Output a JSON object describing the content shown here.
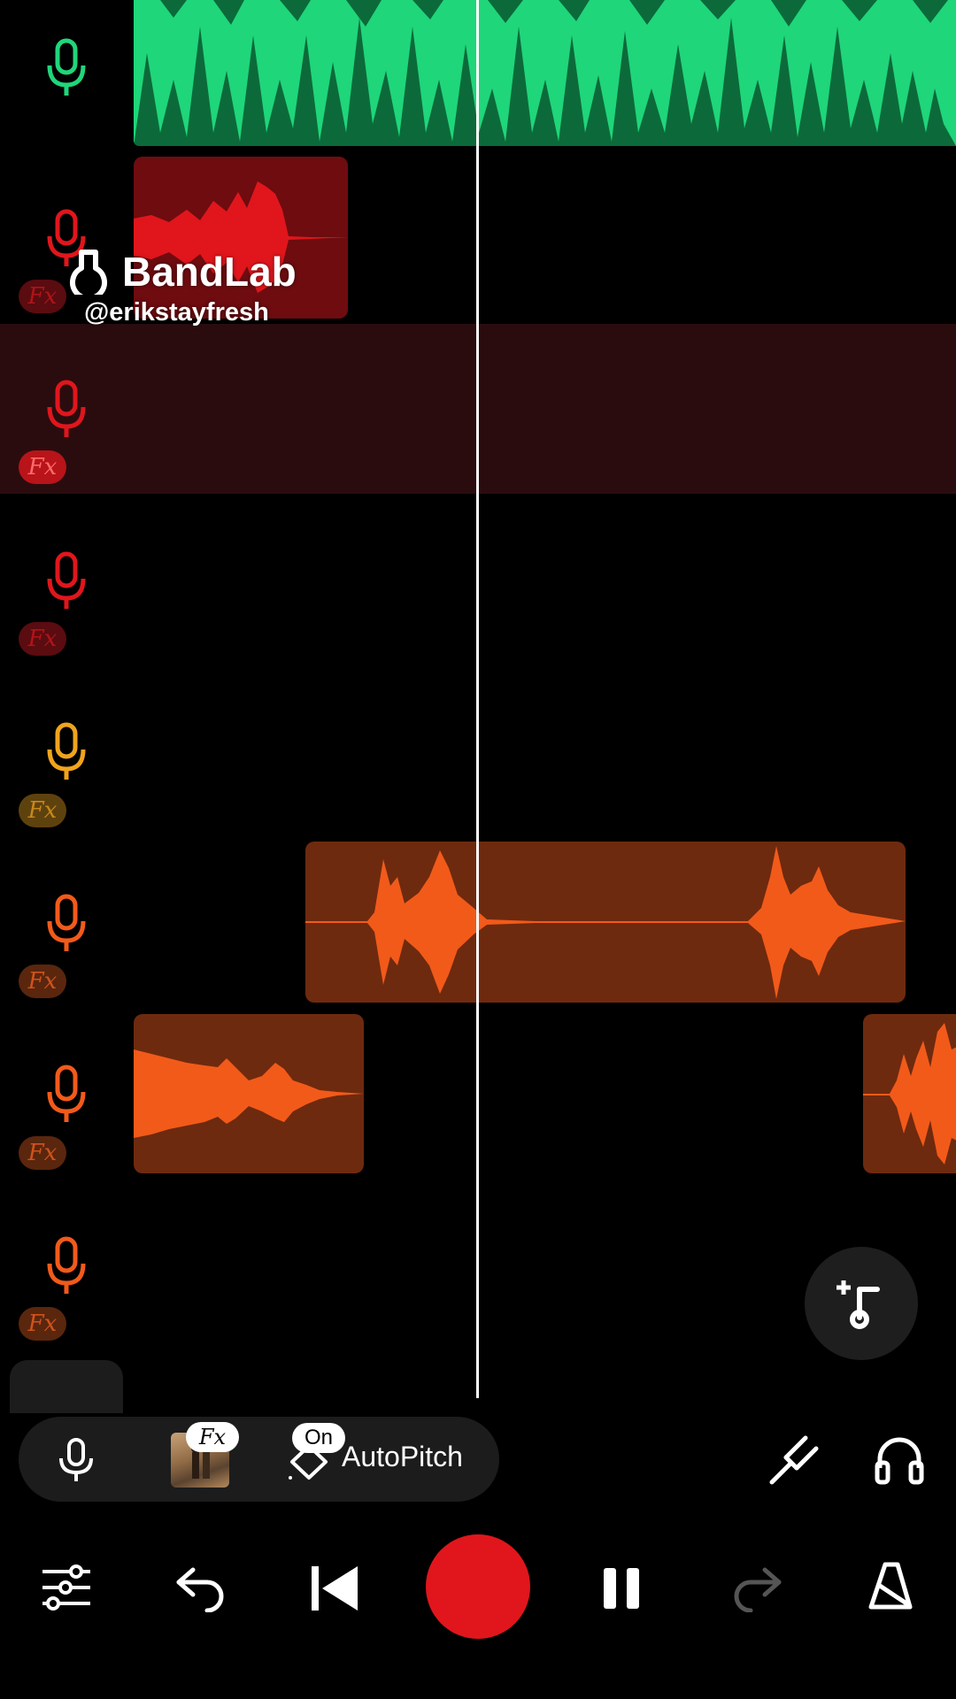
{
  "app": "BandLab",
  "watermark": {
    "brand": "BandLab",
    "handle": "@erikstayfresh"
  },
  "tracks": [
    {
      "id": 1,
      "color": "#1fd67a",
      "fx_label": ""
    },
    {
      "id": 2,
      "color": "#e0161c",
      "fx_label": "Fx"
    },
    {
      "id": 3,
      "color": "#e0161c",
      "fx_label": "Fx",
      "selected": true
    },
    {
      "id": 4,
      "color": "#e0161c",
      "fx_label": "Fx"
    },
    {
      "id": 5,
      "color": "#f0a41c",
      "fx_label": "Fx"
    },
    {
      "id": 6,
      "color": "#f25a1a",
      "fx_label": "Fx"
    },
    {
      "id": 7,
      "color": "#f25a1a",
      "fx_label": "Fx"
    },
    {
      "id": 8,
      "color": "#f25a1a",
      "fx_label": "Fx"
    }
  ],
  "colors": {
    "green_wave": "#1fd67a",
    "green_bg": "#0c6a3a",
    "red_wave": "#e0161c",
    "red_bg": "#6e0c10",
    "orange_wave": "#f25a1a",
    "orange_bg": "#6e2a0e",
    "selected_row": "#2a0c0f",
    "record": "#e0161c"
  },
  "add_track_icon": "add-music-note-icon",
  "input_bar": {
    "mic_icon": "microphone-icon",
    "fx_badge": "Fx",
    "autopitch_badge": "On",
    "autopitch_label": "AutoPitch",
    "tuner_icon": "tuning-fork-icon",
    "headphones_icon": "headphones-icon"
  },
  "transport": {
    "mixer_icon": "sliders-icon",
    "undo_icon": "undo-icon",
    "skip_start_icon": "skip-back-icon",
    "record_icon": "record-button",
    "pause_icon": "pause-icon",
    "redo_icon": "redo-icon",
    "metronome_icon": "metronome-icon"
  }
}
